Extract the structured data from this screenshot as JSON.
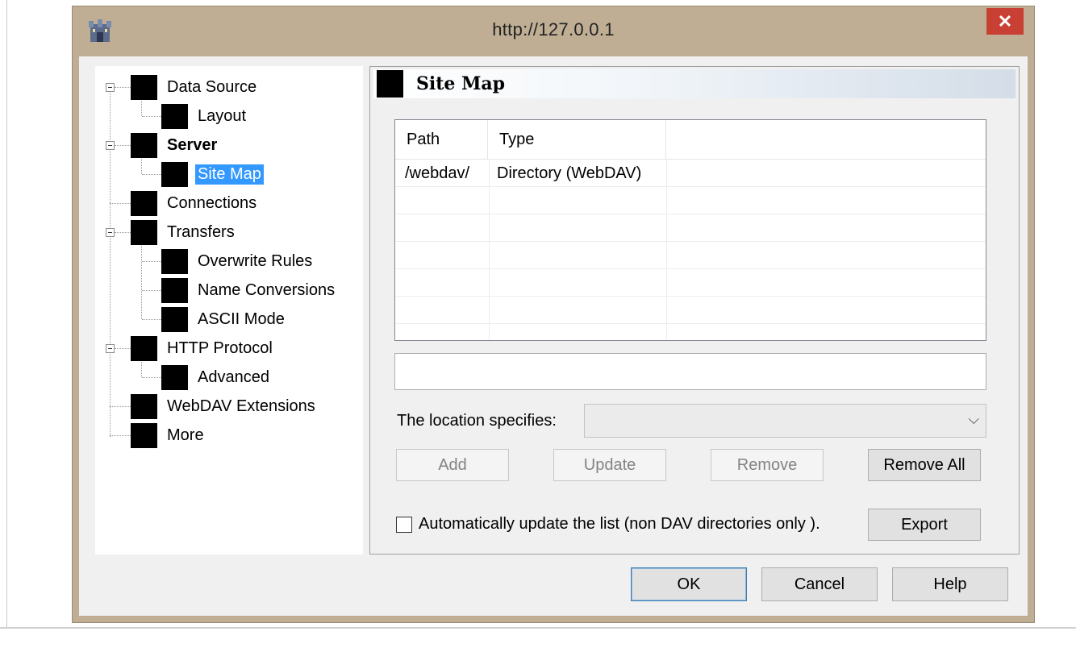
{
  "window": {
    "title": "http://127.0.0.1",
    "close_glyph": "✕"
  },
  "tree": {
    "items": [
      {
        "label": "Data Source",
        "bold": false,
        "selected": false
      },
      {
        "label": "Layout",
        "bold": false,
        "selected": false
      },
      {
        "label": "Server",
        "bold": true,
        "selected": false
      },
      {
        "label": "Site Map",
        "bold": false,
        "selected": true
      },
      {
        "label": "Connections",
        "bold": false,
        "selected": false
      },
      {
        "label": "Transfers",
        "bold": false,
        "selected": false
      },
      {
        "label": "Overwrite Rules",
        "bold": false,
        "selected": false
      },
      {
        "label": "Name Conversions",
        "bold": false,
        "selected": false
      },
      {
        "label": "ASCII Mode",
        "bold": false,
        "selected": false
      },
      {
        "label": "HTTP Protocol",
        "bold": false,
        "selected": false
      },
      {
        "label": "Advanced",
        "bold": false,
        "selected": false
      },
      {
        "label": "WebDAV Extensions",
        "bold": false,
        "selected": false
      },
      {
        "label": "More",
        "bold": false,
        "selected": false
      }
    ]
  },
  "panel": {
    "title": "Site Map",
    "columns": [
      "Path",
      "Type"
    ],
    "rows": [
      {
        "path": "/webdav/",
        "type": "Directory (WebDAV)"
      }
    ],
    "path_value": "",
    "location_label": "The location specifies:",
    "location_value": "",
    "buttons": {
      "add": "Add",
      "update": "Update",
      "remove": "Remove",
      "remove_all": "Remove All",
      "export": "Export"
    },
    "auto_update_label": "Automatically update the list (non DAV directories only ).",
    "auto_update_checked": false
  },
  "footer": {
    "ok": "OK",
    "cancel": "Cancel",
    "help": "Help"
  },
  "colors": {
    "window_frame": "#bfae94",
    "close_button": "#c74033",
    "selection": "#3399ff"
  }
}
